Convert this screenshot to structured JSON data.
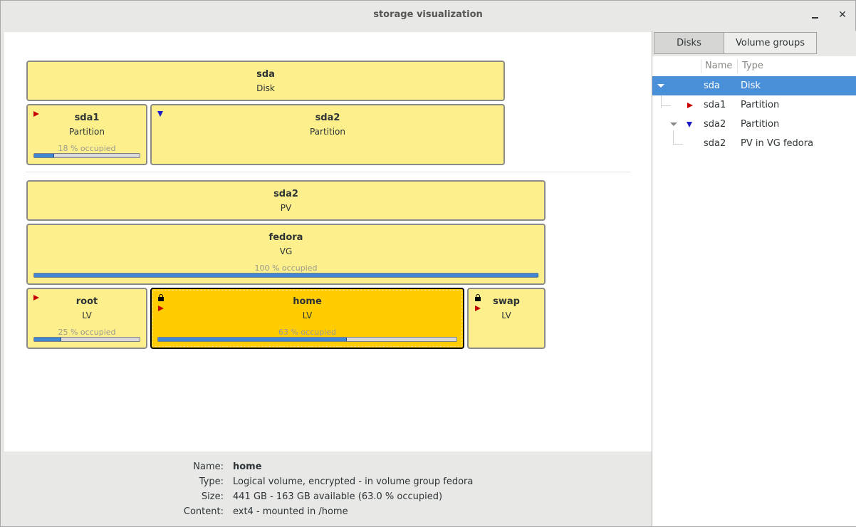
{
  "window": {
    "title": "storage visualization"
  },
  "visual": {
    "disk": {
      "name": "sda",
      "type": "Disk"
    },
    "partitions": [
      {
        "name": "sda1",
        "type": "Partition",
        "occupied_text": "18 % occupied",
        "occupied": 0.18,
        "marker": "red-triangle"
      },
      {
        "name": "sda2",
        "type": "Partition",
        "marker": "blue-triangle"
      }
    ],
    "pv": {
      "name": "sda2",
      "type": "PV"
    },
    "vg": {
      "name": "fedora",
      "type": "VG",
      "occupied_text": "100 % occupied",
      "occupied": 1.0
    },
    "lvs": [
      {
        "name": "root",
        "type": "LV",
        "occupied_text": "25 % occupied",
        "occupied": 0.25
      },
      {
        "name": "home",
        "type": "LV",
        "occupied_text": "63 % occupied",
        "occupied": 0.63,
        "selected": true
      },
      {
        "name": "swap",
        "type": "LV"
      }
    ]
  },
  "info": {
    "name_label": "Name:",
    "name_value": "home",
    "type_label": "Type:",
    "type_value": "Logical volume, encrypted - in volume group fedora",
    "size_label": "Size:",
    "size_value": "441 GB - 163 GB available (63.0 % occupied)",
    "content_label": "Content:",
    "content_value": "ext4 - mounted in /home"
  },
  "sidebar": {
    "tabs": [
      {
        "label": "Disks",
        "active": true
      },
      {
        "label": "Volume groups",
        "active": false
      }
    ],
    "columns": {
      "name": "Name",
      "type": "Type"
    },
    "rows": [
      {
        "name": "sda",
        "type": "Disk"
      },
      {
        "name": "sda1",
        "type": "Partition"
      },
      {
        "name": "sda2",
        "type": "Partition"
      },
      {
        "name": "sda2",
        "type": "PV in VG fedora"
      }
    ]
  },
  "colors": {
    "block": "#fcef8c",
    "selected_block": "#ffcc00",
    "bar_fill": "#3f86d3",
    "tree_selection": "#4a90d9",
    "red_marker": "#c40000",
    "blue_marker": "#1b1bc9"
  },
  "icons": {
    "expand": "red-triangle-icon",
    "collapse": "blue-triangle-icon",
    "encrypted": "lock-icon"
  }
}
